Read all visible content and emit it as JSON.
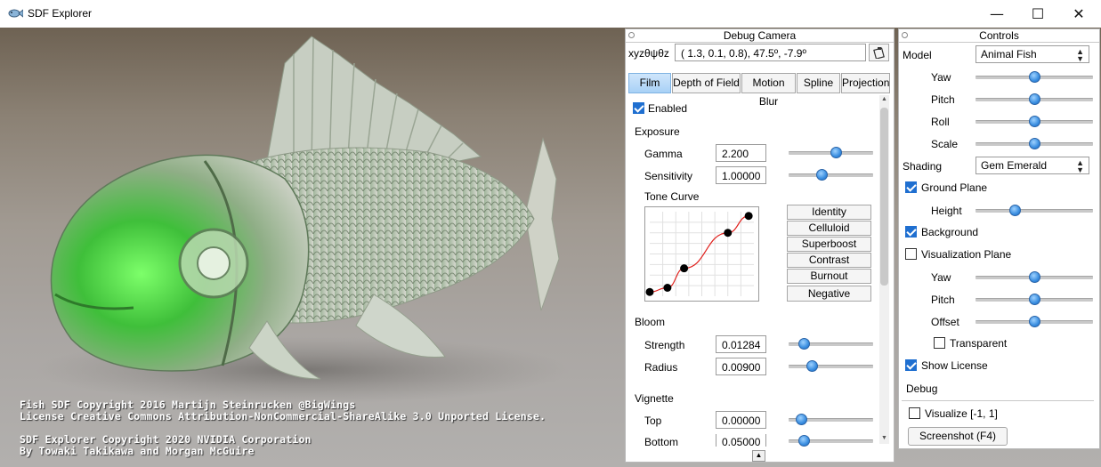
{
  "window": {
    "title": "SDF Explorer",
    "controls": {
      "minimize": "—",
      "maximize": "☐",
      "close": "✕"
    }
  },
  "viewport": {
    "license_lines": [
      "Fish SDF Copyright 2016 Martijn Steinrucken @BigWings",
      "License Creative Commons Attribution-NonCommercial-ShareAlike 3.0 Unported License.",
      "SDF Explorer Copyright 2020 NVIDIA Corporation",
      "By Towaki Takikawa and Morgan McGuire"
    ]
  },
  "debug_camera": {
    "title": "Debug Camera",
    "coord_label": "xyzθψθz",
    "coords_value": "(  1.3,   0.1,   0.8),  47.5º,  -7.9º",
    "tabs": [
      {
        "label": "Film",
        "active": true
      },
      {
        "label": "Depth of Field",
        "active": false
      },
      {
        "label": "Motion Blur",
        "active": false
      },
      {
        "label": "Spline",
        "active": false
      },
      {
        "label": "Projection",
        "active": false
      }
    ],
    "enabled_label": "Enabled",
    "enabled": true,
    "exposure": {
      "heading": "Exposure",
      "gamma_label": "Gamma",
      "gamma_value": "2.200",
      "gamma_level": 0.57,
      "sensitivity_label": "Sensitivity",
      "sensitivity_value": "1.00000",
      "sensitivity_level": 0.38
    },
    "tone_curve": {
      "label": "Tone Curve",
      "points": [
        [
          0.0,
          0.05
        ],
        [
          0.17,
          0.1
        ],
        [
          0.33,
          0.33
        ],
        [
          0.75,
          0.75
        ],
        [
          0.95,
          0.95
        ]
      ],
      "presets": [
        "Identity",
        "Celluloid",
        "Superboost",
        "Contrast",
        "Burnout",
        "Negative"
      ]
    },
    "bloom": {
      "heading": "Bloom",
      "strength_label": "Strength",
      "strength_value": "0.01284",
      "strength_level": 0.14,
      "radius_label": "Radius",
      "radius_value": "0.00900",
      "radius_level": 0.24
    },
    "vignette": {
      "heading": "Vignette",
      "top_label": "Top",
      "top_value": "0.00000",
      "top_level": 0.1,
      "bottom_label": "Bottom",
      "bottom_value": "0.05000",
      "bottom_level": 0.14
    }
  },
  "controls": {
    "title": "Controls",
    "model_label": "Model",
    "model_value": "Animal Fish",
    "model_yaw_label": "Yaw",
    "model_yaw_level": 0.5,
    "model_pitch_label": "Pitch",
    "model_pitch_level": 0.5,
    "model_roll_label": "Roll",
    "model_roll_level": 0.5,
    "model_scale_label": "Scale",
    "model_scale_level": 0.5,
    "shading_label": "Shading",
    "shading_value": "Gem Emerald",
    "ground_plane_label": "Ground Plane",
    "ground_plane": true,
    "height_label": "Height",
    "height_level": 0.32,
    "background_label": "Background",
    "background": true,
    "vis_plane_label": "Visualization Plane",
    "vis_plane": false,
    "vis_yaw_label": "Yaw",
    "vis_yaw_level": 0.5,
    "vis_pitch_label": "Pitch",
    "vis_pitch_level": 0.5,
    "vis_offset_label": "Offset",
    "vis_offset_level": 0.5,
    "transparent_label": "Transparent",
    "transparent": false,
    "show_license_label": "Show License",
    "show_license": true,
    "debug_label": "Debug",
    "visualize_label": "Visualize [-1, 1]",
    "visualize": false,
    "screenshot_label": "Screenshot (F4)"
  }
}
